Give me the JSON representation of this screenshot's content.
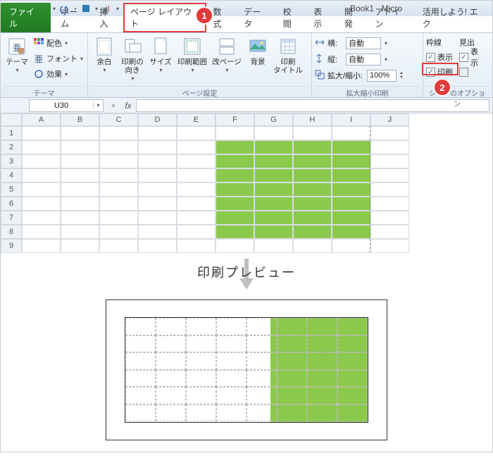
{
  "window": {
    "title": "Book1 - Micro"
  },
  "tabs": {
    "file": "ファイル",
    "home": "ホーム",
    "insert": "挿入",
    "pagelayout": "ページ レイアウト",
    "formulas": "数式",
    "data": "データ",
    "review": "校閲",
    "view": "表示",
    "developer": "開発",
    "addin": "アドイン",
    "katsuyo": "活用しよう! エク"
  },
  "callouts": {
    "one": "1",
    "two": "2"
  },
  "ribbon": {
    "themes": {
      "group_label": "テーマ",
      "theme": "テーマ",
      "colors": "配色",
      "fonts": "フォント",
      "effects": "効果"
    },
    "pagesetup": {
      "group_label": "ページ設定",
      "margins": "余白",
      "orientation": "印刷の\n向き",
      "size": "サイズ",
      "printarea": "印刷範囲",
      "breaks": "改ページ",
      "background": "背景",
      "printtitles": "印刷\nタイトル"
    },
    "scale": {
      "group_label": "拡大縮小印刷",
      "width_lbl": "横:",
      "height_lbl": "縦:",
      "auto": "自動",
      "scale_lbl": "拡大/縮小:",
      "scale_val": "100%"
    },
    "sheetopts": {
      "group_label": "シートのオプション",
      "gridlines": "枠線",
      "headings": "見出",
      "view": "表示",
      "print": "印刷"
    }
  },
  "formula": {
    "cellref": "U30",
    "fx": "fx"
  },
  "columns": [
    "A",
    "B",
    "C",
    "D",
    "E",
    "F",
    "G",
    "H",
    "I",
    "J"
  ],
  "rows": [
    "1",
    "2",
    "3",
    "4",
    "5",
    "6",
    "7",
    "8",
    "9"
  ],
  "preview": {
    "title": "印刷プレビュー"
  }
}
